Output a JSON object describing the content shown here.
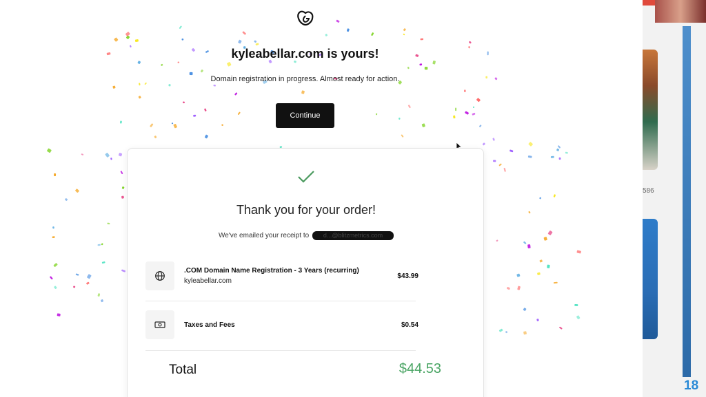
{
  "page": {
    "headline": "kyleabellar.com is yours!",
    "subline": "Domain registration in progress. Almost ready for action.",
    "continue_label": "Continue"
  },
  "icons": {
    "logo": "godaddy-logo-icon",
    "check": "checkmark-icon",
    "domain": "globe-icon",
    "taxes": "cash-icon"
  },
  "colors": {
    "button": "#111111",
    "total": "#4aa564",
    "check": "#4a9a5e"
  },
  "order": {
    "title": "Thank you for your order!",
    "receipt_prefix": "We've emailed your receipt to",
    "receipt_email_redacted": "d...@blitzmetrics.com",
    "items": [
      {
        "name": ".COM Domain Name Registration - 3 Years (recurring)",
        "subtitle": "kyleabellar.com",
        "price": "$43.99"
      },
      {
        "name": "Taxes and Fees",
        "subtitle": "",
        "price": "$0.54"
      }
    ],
    "total_label": "Total",
    "total_value": "$44.53"
  },
  "background_tabs": {
    "text": "586",
    "number": "18"
  }
}
